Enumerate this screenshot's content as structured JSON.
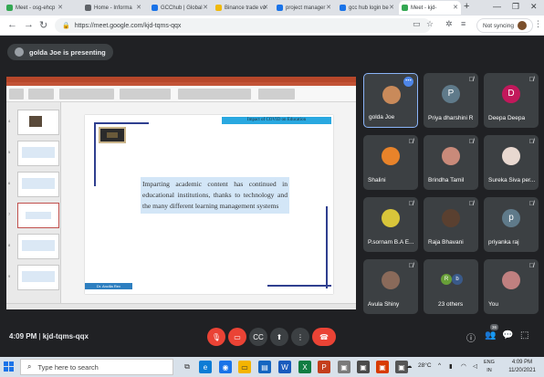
{
  "browser": {
    "tabs": [
      {
        "label": "Meet - osg-ehcp",
        "color": "#34a853"
      },
      {
        "label": "Home - Informa",
        "color": "#5f6368"
      },
      {
        "label": "GCChub | Global",
        "color": "#1a73e8"
      },
      {
        "label": "Binance trade vo",
        "color": "#f0b90b"
      },
      {
        "label": "project manager",
        "color": "#1a73e8"
      },
      {
        "label": "gcc hub login be",
        "color": "#1a73e8"
      },
      {
        "label": "Meet - kjd-",
        "color": "#34a853"
      }
    ],
    "url": "https://meet.google.com/kjd-tqms-qqx",
    "sync_label": "Not syncing"
  },
  "meet": {
    "presenting_label": "golda Joe is presenting",
    "time": "4:09 PM",
    "meeting_code": "kjd-tqms-qqx",
    "people_count": "36"
  },
  "slide": {
    "banner": "Impact of COVID on Education",
    "body": "Imparting academic content has continued in educational institutions, thanks to technology and the many different learning management systems",
    "footer": "Dr. Ancilla Rev"
  },
  "participants": [
    {
      "name": "golda Joe",
      "type": "photo",
      "color": "#c98a5a"
    },
    {
      "name": "Priya dharshini R",
      "type": "letter",
      "letter": "P",
      "color": "#5f7a8a"
    },
    {
      "name": "Deepa Deepa",
      "type": "letter",
      "letter": "D",
      "color": "#c2185b"
    },
    {
      "name": "Shalini",
      "type": "photo",
      "color": "#e8832a"
    },
    {
      "name": "Brindha Tamil",
      "type": "photo",
      "color": "#c98a7a"
    },
    {
      "name": "Sureka Siva per...",
      "type": "photo",
      "color": "#e8d8d0"
    },
    {
      "name": "P.sornam B.A E...",
      "type": "photo",
      "color": "#d8c53a"
    },
    {
      "name": "Raja Bhavani",
      "type": "photo",
      "color": "#5a4030"
    },
    {
      "name": "priyanka raj",
      "type": "letter",
      "letter": "p",
      "color": "#5f7a8a"
    },
    {
      "name": "Avula Shiny",
      "type": "photo",
      "color": "#8a6a5a"
    },
    {
      "name": "23 others",
      "type": "others",
      "letters": [
        "R",
        "b"
      ]
    },
    {
      "name": "You",
      "type": "photo",
      "color": "#c08080"
    }
  ],
  "taskbar": {
    "search_placeholder": "Type here to search",
    "weather": "28°C",
    "lang_top": "ENG",
    "lang_bottom": "IN",
    "time": "4:09 PM",
    "date": "11/20/2021"
  }
}
